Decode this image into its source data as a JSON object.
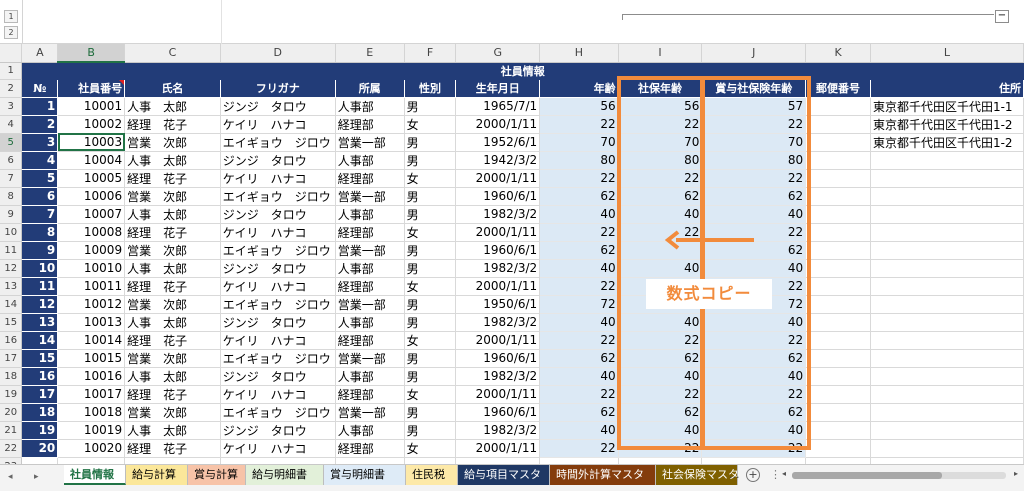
{
  "outline": {
    "levels": [
      "1",
      "2"
    ],
    "collapse_button": "−"
  },
  "columns": [
    "A",
    "B",
    "C",
    "D",
    "E",
    "F",
    "G",
    "H",
    "I",
    "J",
    "K",
    "L"
  ],
  "sheet_title": "社員情報",
  "headers": [
    "№",
    "社員番号",
    "氏名",
    "フリガナ",
    "所属",
    "性別",
    "生年月日",
    "年齢",
    "社保年齢",
    "賞与社保険年齢",
    "郵便番号",
    "住所"
  ],
  "rows": [
    [
      "1",
      "10001",
      "人事　太郎",
      "ジンジ　タロウ",
      "人事部",
      "男",
      "1965/7/1",
      "56",
      "56",
      "57",
      "",
      "東京都千代田区千代田1-1"
    ],
    [
      "2",
      "10002",
      "経理　花子",
      "ケイリ　ハナコ",
      "経理部",
      "女",
      "2000/1/11",
      "22",
      "22",
      "22",
      "",
      "東京都千代田区千代田1-2"
    ],
    [
      "3",
      "10003",
      "営業　次郎",
      "エイギョウ　ジロウ",
      "営業一部",
      "男",
      "1952/6/1",
      "70",
      "70",
      "70",
      "",
      "東京都千代田区千代田1-2"
    ],
    [
      "4",
      "10004",
      "人事　太郎",
      "ジンジ　タロウ",
      "人事部",
      "男",
      "1942/3/2",
      "80",
      "80",
      "80",
      "",
      ""
    ],
    [
      "5",
      "10005",
      "経理　花子",
      "ケイリ　ハナコ",
      "経理部",
      "女",
      "2000/1/11",
      "22",
      "22",
      "22",
      "",
      ""
    ],
    [
      "6",
      "10006",
      "営業　次郎",
      "エイギョウ　ジロウ",
      "営業一部",
      "男",
      "1960/6/1",
      "62",
      "62",
      "62",
      "",
      ""
    ],
    [
      "7",
      "10007",
      "人事　太郎",
      "ジンジ　タロウ",
      "人事部",
      "男",
      "1982/3/2",
      "40",
      "40",
      "40",
      "",
      ""
    ],
    [
      "8",
      "10008",
      "経理　花子",
      "ケイリ　ハナコ",
      "経理部",
      "女",
      "2000/1/11",
      "22",
      "22",
      "22",
      "",
      ""
    ],
    [
      "9",
      "10009",
      "営業　次郎",
      "エイギョウ　ジロウ",
      "営業一部",
      "男",
      "1960/6/1",
      "62",
      "",
      "62",
      "",
      ""
    ],
    [
      "10",
      "10010",
      "人事　太郎",
      "ジンジ　タロウ",
      "人事部",
      "男",
      "1982/3/2",
      "40",
      "40",
      "40",
      "",
      ""
    ],
    [
      "11",
      "10011",
      "経理　花子",
      "ケイリ　ハナコ",
      "経理部",
      "女",
      "2000/1/11",
      "22",
      "22",
      "22",
      "",
      ""
    ],
    [
      "12",
      "10012",
      "営業　次郎",
      "エイギョウ　ジロウ",
      "営業一部",
      "男",
      "1950/6/1",
      "72",
      "",
      "72",
      "",
      ""
    ],
    [
      "13",
      "10013",
      "人事　太郎",
      "ジンジ　タロウ",
      "人事部",
      "男",
      "1982/3/2",
      "40",
      "40",
      "40",
      "",
      ""
    ],
    [
      "14",
      "10014",
      "経理　花子",
      "ケイリ　ハナコ",
      "経理部",
      "女",
      "2000/1/11",
      "22",
      "22",
      "22",
      "",
      ""
    ],
    [
      "15",
      "10015",
      "営業　次郎",
      "エイギョウ　ジロウ",
      "営業一部",
      "男",
      "1960/6/1",
      "62",
      "62",
      "62",
      "",
      ""
    ],
    [
      "16",
      "10016",
      "人事　太郎",
      "ジンジ　タロウ",
      "人事部",
      "男",
      "1982/3/2",
      "40",
      "40",
      "40",
      "",
      ""
    ],
    [
      "17",
      "10017",
      "経理　花子",
      "ケイリ　ハナコ",
      "経理部",
      "女",
      "2000/1/11",
      "22",
      "22",
      "22",
      "",
      ""
    ],
    [
      "18",
      "10018",
      "営業　次郎",
      "エイギョウ　ジロウ",
      "営業一部",
      "男",
      "1960/6/1",
      "62",
      "62",
      "62",
      "",
      ""
    ],
    [
      "19",
      "10019",
      "人事　太郎",
      "ジンジ　タロウ",
      "人事部",
      "男",
      "1982/3/2",
      "40",
      "40",
      "40",
      "",
      ""
    ],
    [
      "20",
      "10020",
      "経理　花子",
      "ケイリ　ハナコ",
      "経理部",
      "女",
      "2000/1/11",
      "22",
      "22",
      "22",
      "",
      ""
    ]
  ],
  "annotation": {
    "label": "数式コピー",
    "color": "#f28b3c"
  },
  "colors": {
    "header_bg": "#223c78",
    "highlight_bg": "#dce9f5",
    "accent_green": "#217346"
  },
  "tabs": [
    {
      "label": "社員情報",
      "bg": "#ffffff",
      "fg": "#217346"
    },
    {
      "label": "給与計算",
      "bg": "#fbe79a",
      "fg": "#000000"
    },
    {
      "label": "賞与計算",
      "bg": "#f7c3a8",
      "fg": "#000000"
    },
    {
      "label": "給与明細書",
      "bg": "#e2f0d9",
      "fg": "#000000"
    },
    {
      "label": "賞与明細書",
      "bg": "#deebf7",
      "fg": "#000000"
    },
    {
      "label": "住民税",
      "bg": "#fde9a8",
      "fg": "#000000"
    },
    {
      "label": "給与項目マスタ",
      "bg": "#1f3864",
      "fg": "#ffffff"
    },
    {
      "label": "時間外計算マスタ",
      "bg": "#843c0c",
      "fg": "#ffffff"
    },
    {
      "label": "社会保険マスタ",
      "bg": "#7f6000",
      "fg": "#ffffff"
    }
  ],
  "tab_more": "...",
  "tab_add": "+"
}
